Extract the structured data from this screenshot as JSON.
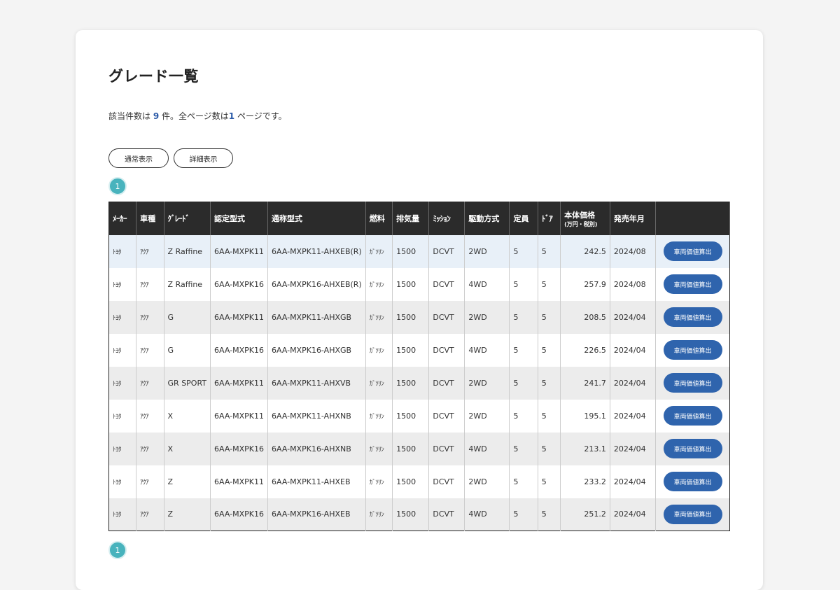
{
  "page": {
    "title": "グレード一覧",
    "count_prefix": "該当件数は ",
    "count": "9",
    "count_mid": " 件。全ページ数は",
    "pages": "1",
    "count_suffix": " ページです。"
  },
  "view_buttons": {
    "normal": "通常表示",
    "detail": "詳細表示"
  },
  "pager": {
    "current": "1"
  },
  "table": {
    "headers": [
      "ﾒｰｶｰ",
      "車種",
      "ｸﾞﾚｰﾄﾞ",
      "認定型式",
      "通称型式",
      "燃料",
      "排気量",
      "ﾐｯｼｮﾝ",
      "駆動方式",
      "定員",
      "ﾄﾞｱ",
      "本体価格",
      "発売年月",
      ""
    ],
    "price_sub": "(万円・税別)",
    "action_label": "車両価値算出",
    "rows": [
      [
        "ﾄﾖﾀ",
        "ｱｸｱ",
        "Z Raffine",
        "6AA-MXPK11",
        "6AA-MXPK11-AHXEB(R)",
        "ｶﾞｿﾘﾝ",
        "1500",
        "DCVT",
        "2WD",
        "5",
        "5",
        "242.5",
        "2024/08"
      ],
      [
        "ﾄﾖﾀ",
        "ｱｸｱ",
        "Z Raffine",
        "6AA-MXPK16",
        "6AA-MXPK16-AHXEB(R)",
        "ｶﾞｿﾘﾝ",
        "1500",
        "DCVT",
        "4WD",
        "5",
        "5",
        "257.9",
        "2024/08"
      ],
      [
        "ﾄﾖﾀ",
        "ｱｸｱ",
        "G",
        "6AA-MXPK11",
        "6AA-MXPK11-AHXGB",
        "ｶﾞｿﾘﾝ",
        "1500",
        "DCVT",
        "2WD",
        "5",
        "5",
        "208.5",
        "2024/04"
      ],
      [
        "ﾄﾖﾀ",
        "ｱｸｱ",
        "G",
        "6AA-MXPK16",
        "6AA-MXPK16-AHXGB",
        "ｶﾞｿﾘﾝ",
        "1500",
        "DCVT",
        "4WD",
        "5",
        "5",
        "226.5",
        "2024/04"
      ],
      [
        "ﾄﾖﾀ",
        "ｱｸｱ",
        "GR SPORT",
        "6AA-MXPK11",
        "6AA-MXPK11-AHXVB",
        "ｶﾞｿﾘﾝ",
        "1500",
        "DCVT",
        "2WD",
        "5",
        "5",
        "241.7",
        "2024/04"
      ],
      [
        "ﾄﾖﾀ",
        "ｱｸｱ",
        "X",
        "6AA-MXPK11",
        "6AA-MXPK11-AHXNB",
        "ｶﾞｿﾘﾝ",
        "1500",
        "DCVT",
        "2WD",
        "5",
        "5",
        "195.1",
        "2024/04"
      ],
      [
        "ﾄﾖﾀ",
        "ｱｸｱ",
        "X",
        "6AA-MXPK16",
        "6AA-MXPK16-AHXNB",
        "ｶﾞｿﾘﾝ",
        "1500",
        "DCVT",
        "4WD",
        "5",
        "5",
        "213.1",
        "2024/04"
      ],
      [
        "ﾄﾖﾀ",
        "ｱｸｱ",
        "Z",
        "6AA-MXPK11",
        "6AA-MXPK11-AHXEB",
        "ｶﾞｿﾘﾝ",
        "1500",
        "DCVT",
        "2WD",
        "5",
        "5",
        "233.2",
        "2024/04"
      ],
      [
        "ﾄﾖﾀ",
        "ｱｸｱ",
        "Z",
        "6AA-MXPK16",
        "6AA-MXPK16-AHXEB",
        "ｶﾞｿﾘﾝ",
        "1500",
        "DCVT",
        "4WD",
        "5",
        "5",
        "251.2",
        "2024/04"
      ]
    ]
  },
  "colors": {
    "accent": "#2f64ad",
    "pager": "#48b3bd",
    "header_bg": "#2b2b2b"
  }
}
